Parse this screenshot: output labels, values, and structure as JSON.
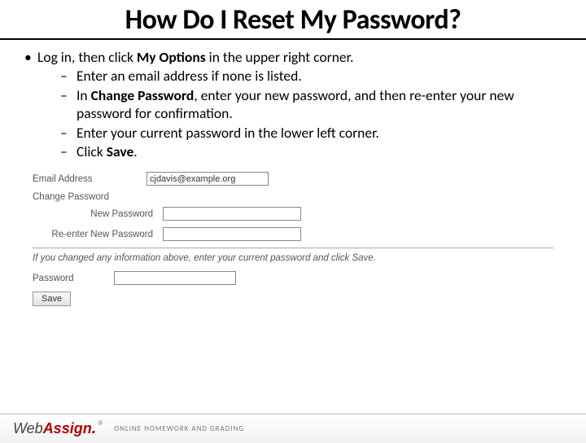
{
  "title": "How Do I Reset My Password?",
  "intro_parts": {
    "a": "Log in, then click ",
    "b": "My Options",
    "c": " in the upper right corner."
  },
  "steps": {
    "s1": "Enter an email address if none is listed.",
    "s2a": "In ",
    "s2b": "Change Password",
    "s2c": ", enter your new password, and then re-enter your new password for confirmation.",
    "s3": "Enter your current password in the lower left corner.",
    "s4a": "Click ",
    "s4b": "Save",
    "s4c": "."
  },
  "form": {
    "email_label": "Email Address",
    "email_value": "cjdavis@example.org",
    "change_pw_header": "Change Password",
    "new_pw_label": "New Password",
    "reenter_label": "Re-enter New Password",
    "note": "If you changed any information above, enter your current password and click Save.",
    "password_label": "Password",
    "save_button": "Save"
  },
  "footer": {
    "logo_web": "Web",
    "logo_assign": "Assign",
    "tm": "®",
    "tagline": "ONLINE HOMEWORK AND GRADING"
  }
}
